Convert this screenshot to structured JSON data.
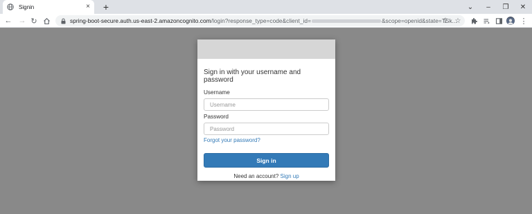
{
  "browser": {
    "tab_title": "Signin",
    "new_tab": "+",
    "url_host": "spring-boot-secure.auth.us-east-2.amazoncognito.com",
    "url_path_prefix": "/login?response_type=code&client_id=",
    "url_path_suffix": "&scope=openid&state=TSk..."
  },
  "form": {
    "heading": "Sign in with your username and password",
    "username_label": "Username",
    "username_placeholder": "Username",
    "username_value": "",
    "password_label": "Password",
    "password_placeholder": "Password",
    "password_value": "",
    "forgot_link": "Forgot your password?",
    "signin_button": "Sign in",
    "need_account": "Need an account?",
    "signup_link": "Sign up"
  },
  "colors": {
    "page_background": "#898989",
    "banner": "#d6d6d6",
    "primary_button": "#337ab7",
    "link": "#337ab7"
  },
  "icons": [
    "globe-icon",
    "close-icon",
    "plus-icon",
    "chevron-down-icon",
    "minimize-icon",
    "restore-icon",
    "close-window-icon",
    "back-icon",
    "forward-icon",
    "reload-icon",
    "home-icon",
    "lock-icon",
    "share-icon",
    "star-icon",
    "extensions-icon",
    "reading-list-icon",
    "side-panel-icon",
    "avatar",
    "more-icon"
  ]
}
